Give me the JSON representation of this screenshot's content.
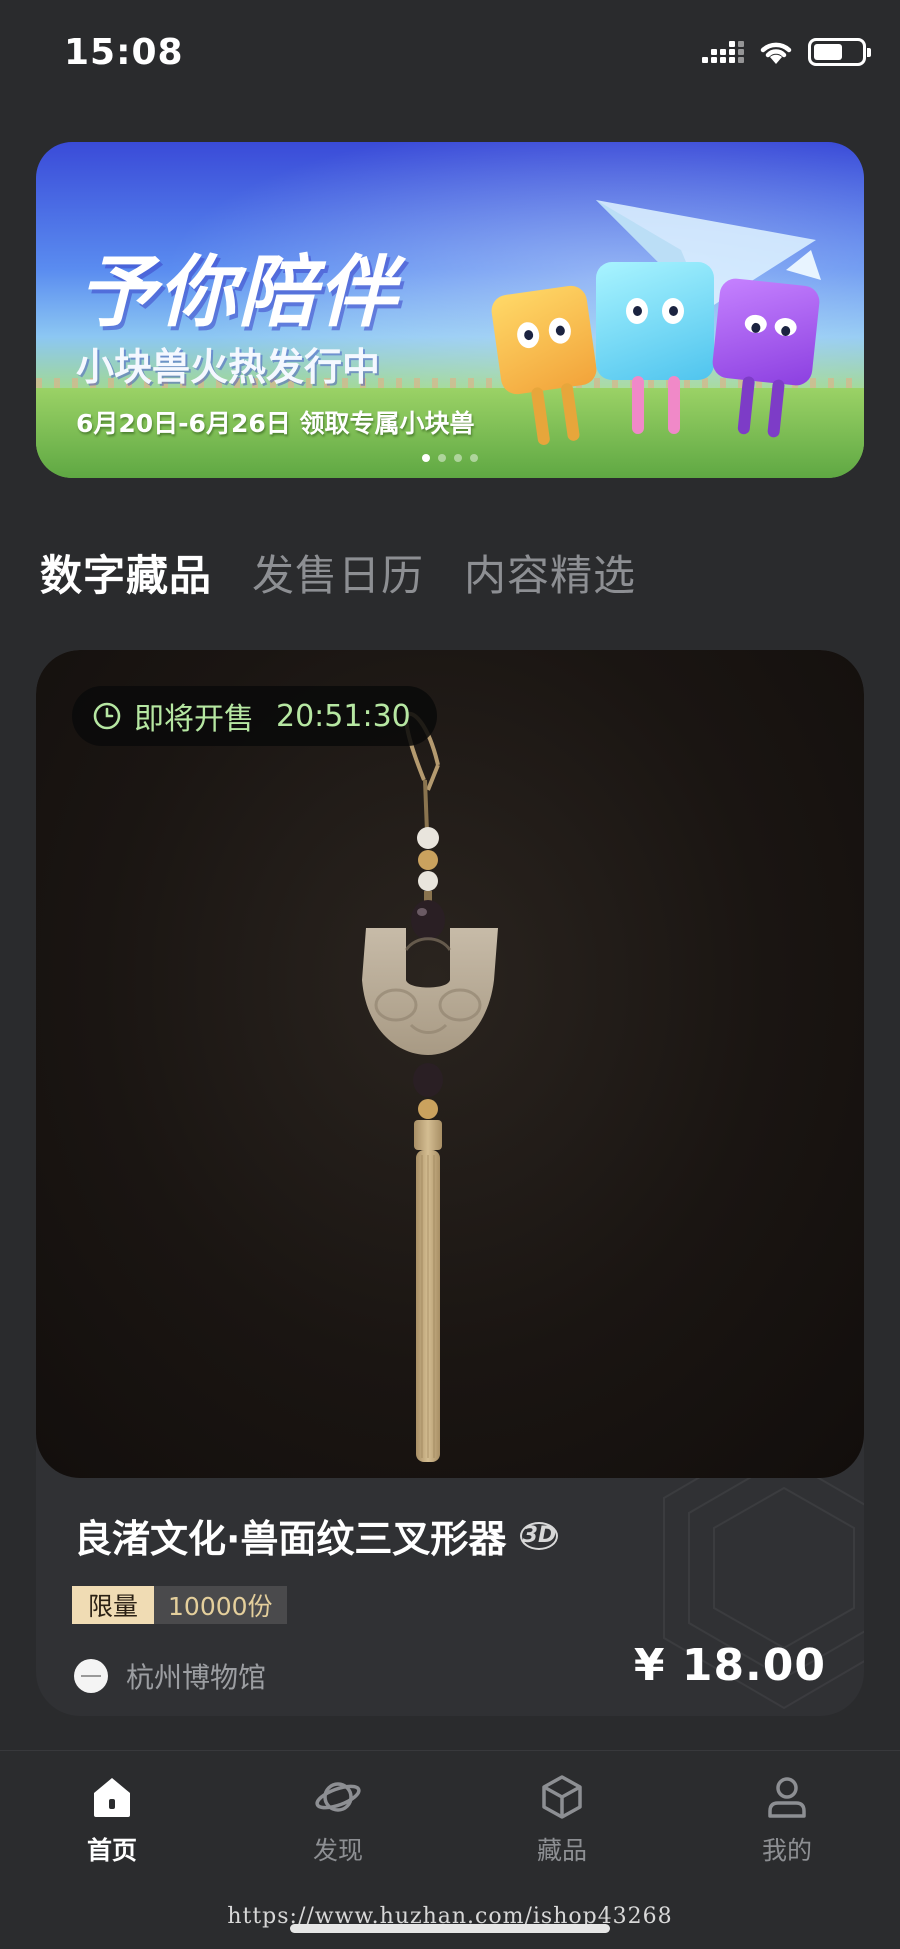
{
  "status_bar": {
    "time": "15:08",
    "battery_level": 0.6
  },
  "banner": {
    "title": "予你陪伴",
    "subtitle": "小块兽火热发行中",
    "dates": "6月20日-6月26日 领取专属小块兽",
    "active_slide": 1,
    "slide_count": 4
  },
  "tabs": [
    {
      "label": "数字藏品",
      "active": true
    },
    {
      "label": "发售日历",
      "active": false
    },
    {
      "label": "内容精选",
      "active": false
    }
  ],
  "product": {
    "countdown_label": "即将开售",
    "countdown_time": "20:51:30",
    "title": "良渚文化·兽面纹三叉形器",
    "badge": "3D",
    "limit_label": "限量",
    "limit_count": "10000份",
    "publisher": "杭州博物馆",
    "price": "¥ 18.00"
  },
  "bottom_nav": [
    {
      "label": "首页",
      "icon": "home-icon",
      "active": true
    },
    {
      "label": "发现",
      "icon": "planet-icon",
      "active": false
    },
    {
      "label": "藏品",
      "icon": "cube-icon",
      "active": false
    },
    {
      "label": "我的",
      "icon": "user-icon",
      "active": false
    }
  ],
  "watermark": "https://www.huzhan.com/ishop43268",
  "colors": {
    "background": "#2a2b2d",
    "card": "#303134",
    "countdown_text": "#b6e7a2",
    "limit_tag": "#f0dcb4",
    "inactive": "#8d8f93"
  }
}
